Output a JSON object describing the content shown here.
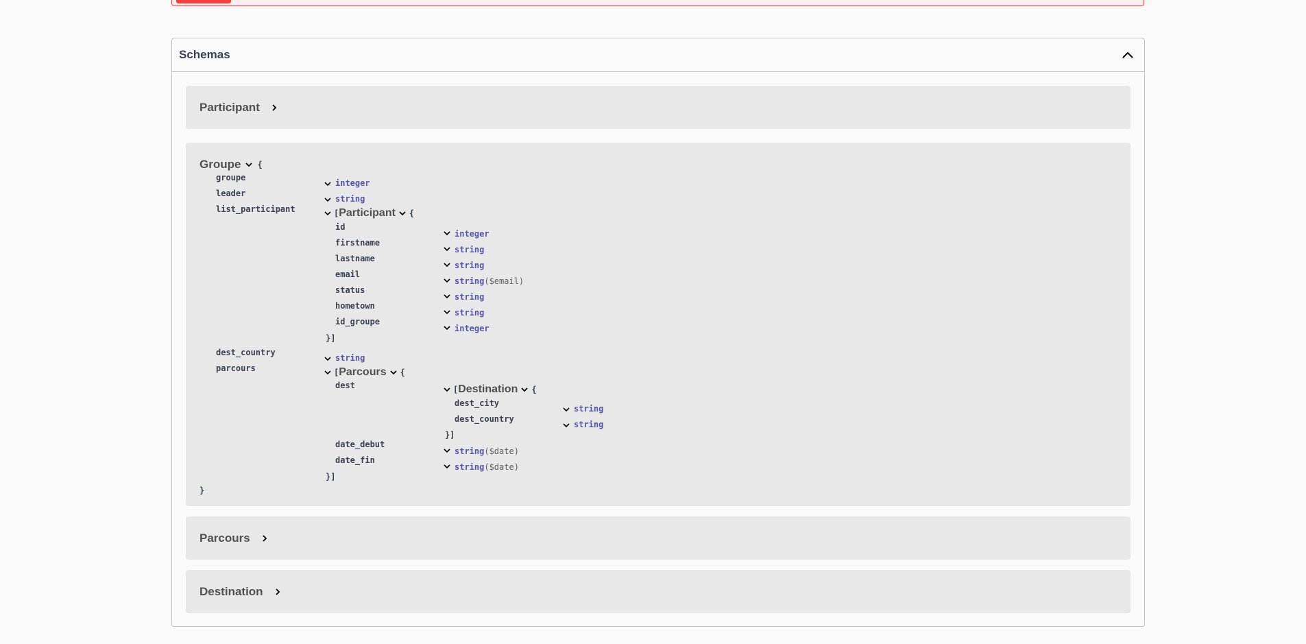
{
  "schemas": {
    "title": "Schemas",
    "models": {
      "participant": {
        "title": "Participant"
      },
      "groupe": {
        "title": "Groupe",
        "open": "{",
        "close": "}",
        "props": {
          "groupe": {
            "name": "groupe",
            "type": "integer"
          },
          "leader": {
            "name": "leader",
            "type": "string"
          },
          "list_participant": {
            "name": "list_participant",
            "open": "[",
            "model": "Participant",
            "brace": "{",
            "close": "}]",
            "props": [
              {
                "name": "id",
                "type": "integer",
                "format": ""
              },
              {
                "name": "firstname",
                "type": "string",
                "format": ""
              },
              {
                "name": "lastname",
                "type": "string",
                "format": ""
              },
              {
                "name": "email",
                "type": "string",
                "format": "($email)"
              },
              {
                "name": "status",
                "type": "string",
                "format": ""
              },
              {
                "name": "hometown",
                "type": "string",
                "format": ""
              },
              {
                "name": "id_groupe",
                "type": "integer",
                "format": ""
              }
            ]
          },
          "dest_country": {
            "name": "dest_country",
            "type": "string"
          },
          "parcours": {
            "name": "parcours",
            "open": "[",
            "model": "Parcours",
            "brace": "{",
            "close": "}]",
            "dest": {
              "name": "dest",
              "open": "[",
              "model": "Destination",
              "brace": "{",
              "close": "}]",
              "props": [
                {
                  "name": "dest_city",
                  "type": "string"
                },
                {
                  "name": "dest_country",
                  "type": "string"
                }
              ]
            },
            "date_debut": {
              "name": "date_debut",
              "type": "string",
              "format": "($date)"
            },
            "date_fin": {
              "name": "date_fin",
              "type": "string",
              "format": "($date)"
            }
          }
        }
      },
      "parcours": {
        "title": "Parcours"
      },
      "destination": {
        "title": "Destination"
      }
    }
  },
  "icons": {
    "collapse": "chevron-up-icon",
    "expand": "chevron-right-icon",
    "toggle": "chevron-down-icon"
  },
  "colors": {
    "type": "#5555aa",
    "error": "#f93e3e",
    "model_bg": "#ececec"
  }
}
